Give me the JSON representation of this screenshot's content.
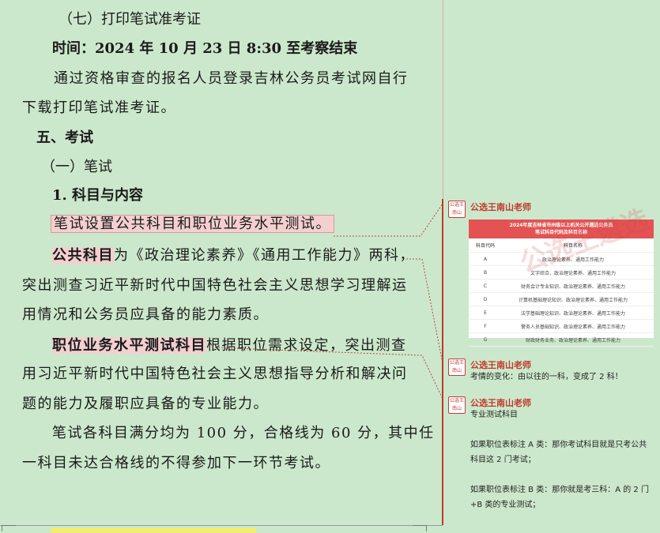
{
  "document": {
    "heading_7": "（七）打印笔试准考证",
    "time_line": "时间：2024 年 10 月 23 日 8:30 至考察结束",
    "para_print_1": "通过资格审查的报名人员登录吉林公务员考试网自行",
    "para_print_2": "下载打印笔试准考证。",
    "heading_5": "五、考试",
    "heading_written": "（一）笔试",
    "heading_subjects": "1. 科目与内容",
    "para_setup": "笔试设置公共科目和职位业务水平测试。",
    "public_subject": "公共科目",
    "public_subject_rest": "为《政治理论素养》《通用工作能力》两科，",
    "para_public_2": "突出测查习近平新时代中国特色社会主义思想学习理解运",
    "para_public_3": "用情况和公务员应具备的能力素质。",
    "position_subject": "职位业务水平测试科目",
    "position_subject_rest": "根据职位需求设定，突出测查",
    "para_position_2": "用习近平新时代中国特色社会主义思想指导分析和解决问",
    "para_position_3": "题的能力及履职应具备的专业能力。",
    "para_score_1": "笔试各科目满分均为 100 分，合格线为 60 分，其中任",
    "para_score_2": "一科目未达合格线的不得参加下一环节考试。"
  },
  "comments": [
    {
      "author": "公选王南山老师",
      "avatar_text": "公选王 南山",
      "table": {
        "title_1": "2024年度吉林省市州级以上机关公开遴选公务员",
        "title_2": "笔试科目代码及科目名称",
        "col_code": "科目代码",
        "col_name": "科目名称",
        "rows": [
          {
            "code": "A",
            "name": "政治理论素养、通用工作能力"
          },
          {
            "code": "B",
            "name": "文字综合、政治理论素养、通用工作能力"
          },
          {
            "code": "C",
            "name": "财务会计专业知识、政治理论素养、通用工作能力"
          },
          {
            "code": "D",
            "name": "计算机基础理论知识、政治理论素养、通用工作能力"
          },
          {
            "code": "E",
            "name": "法学基础理论知识、政治理论素养、通用工作能力"
          },
          {
            "code": "F",
            "name": "警务人员基础知识、政治理论素养、通用工作能力"
          },
          {
            "code": "G",
            "name": "财政财务业务、政治理论素养、通用工作能力"
          }
        ],
        "watermark": "公选王遴选"
      }
    },
    {
      "author": "公选王南山老师",
      "avatar_text": "公选王 南山",
      "text": "考情的变化：由以往的一科，变成了 2 科！"
    },
    {
      "author": "公选王南山老师",
      "avatar_text": "公选王 南山",
      "lines": [
        "专业测试科目",
        "",
        "如果职位表标注 A 类：那你考试科目就是只考公共",
        "科目这 2 门考试；",
        "",
        "如果职位表标注 B 类：那你就是考三科：A 的 2 门",
        "+B 类的专业测试；"
      ]
    }
  ],
  "colors": {
    "page_bg": "#cce8cc",
    "highlight": "#f3cfd0",
    "comment_author": "#c0392b",
    "table_header": "#e35353"
  }
}
